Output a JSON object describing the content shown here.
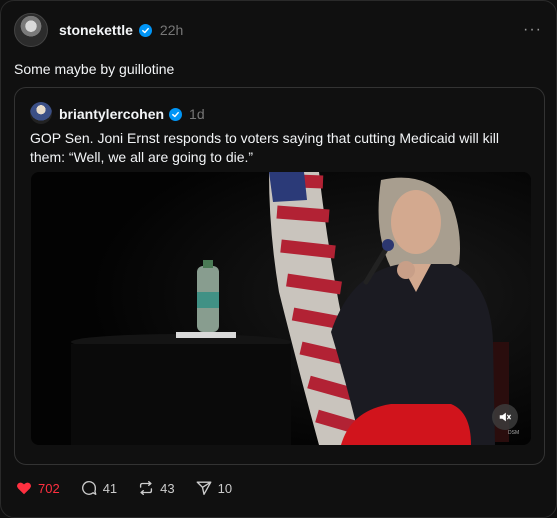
{
  "post": {
    "username": "stonekettle",
    "time": "22h",
    "more_label": "···",
    "text": "Some maybe by guillotine"
  },
  "quote": {
    "username": "briantylercohen",
    "time": "1d",
    "text": "GOP Sen. Joni Ernst responds to voters saying that cutting Medicaid will kill them: “Well, we all are going to die.”"
  },
  "actions": {
    "likes": "702",
    "replies": "41",
    "reposts": "43",
    "shares": "10"
  },
  "colors": {
    "background": "#101010",
    "verified": "#0095f6",
    "like": "#ff3040"
  },
  "icons": [
    "verified-badge-icon",
    "more-icon",
    "mute-icon",
    "heart-icon",
    "comment-icon",
    "repost-icon",
    "share-icon"
  ]
}
